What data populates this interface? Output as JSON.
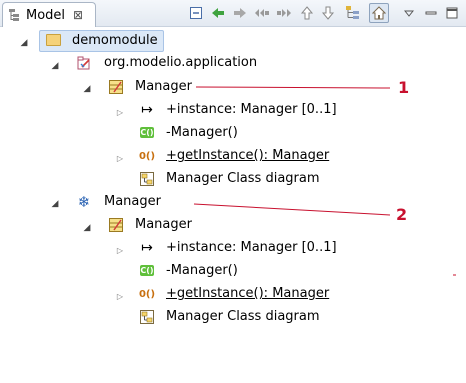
{
  "view": {
    "tab_title": "Model",
    "close_glyph": "⊠"
  },
  "toolbar": {
    "icons": [
      "collapse-all-icon",
      "back-icon",
      "forward-icon",
      "navigate-prev-icon",
      "navigate-next-icon",
      "move-up-icon",
      "move-down-icon",
      "link-with-editor-icon",
      "home-icon",
      "view-menu-icon",
      "minimize-icon",
      "maximize-icon"
    ]
  },
  "tree": {
    "root": "demomodule",
    "package": "org.modelio.application",
    "class1": {
      "name": "Manager",
      "attribute": "+instance: Manager [0..1]",
      "constructor": "-Manager()",
      "operation": "+getInstance(): Manager",
      "diagram": "Manager Class diagram"
    },
    "component": "Manager",
    "class2": {
      "name": "Manager",
      "attribute": "+instance: Manager [0..1]",
      "constructor": "-Manager()",
      "operation": "+getInstance(): Manager",
      "diagram": "Manager Class diagram"
    }
  },
  "annotations": {
    "label1": "1",
    "label2": "2",
    "color": "#c8102e"
  }
}
